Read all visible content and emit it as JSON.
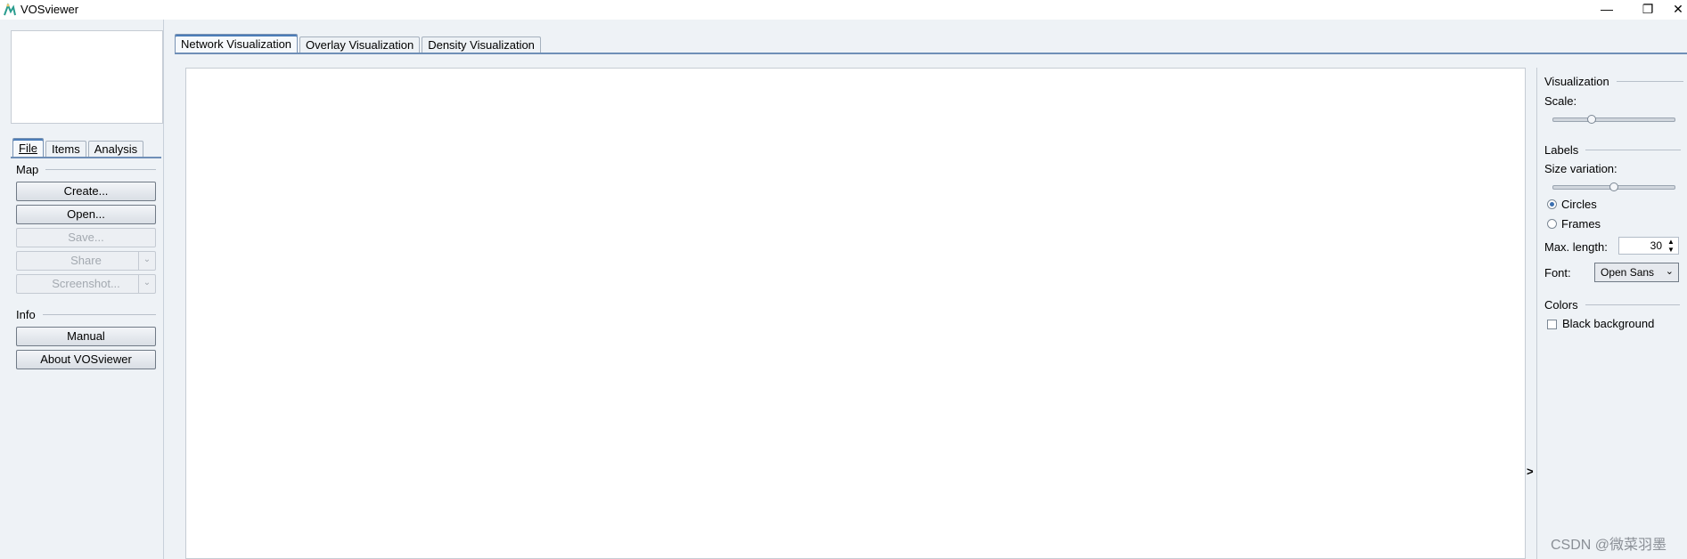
{
  "window": {
    "title": "VOSviewer",
    "controls": {
      "minimize": "—",
      "restore": "❐",
      "close": "✕"
    }
  },
  "left": {
    "tabs": [
      "File",
      "Items",
      "Analysis"
    ],
    "map_group": "Map",
    "buttons": {
      "create": "Create...",
      "open": "Open...",
      "save": "Save...",
      "share": "Share",
      "screenshot": "Screenshot..."
    },
    "info_group": "Info",
    "info_buttons": {
      "manual": "Manual",
      "about": "About VOSviewer"
    }
  },
  "center": {
    "tabs": [
      "Network Visualization",
      "Overlay Visualization",
      "Density Visualization"
    ],
    "expander": ">"
  },
  "right": {
    "visualization": "Visualization",
    "scale_label": "Scale:",
    "scale_value": 0.3,
    "labels": "Labels",
    "size_variation_label": "Size variation:",
    "size_variation_value": 0.5,
    "circles": "Circles",
    "frames": "Frames",
    "max_length_label": "Max. length:",
    "max_length_value": "30",
    "font_label": "Font:",
    "font_value": "Open Sans",
    "colors": "Colors",
    "black_background": "Black background"
  },
  "watermark": "CSDN @微菜羽墨",
  "colors": {
    "accent": "#3b6fb0",
    "panel": "#eef2f6"
  }
}
